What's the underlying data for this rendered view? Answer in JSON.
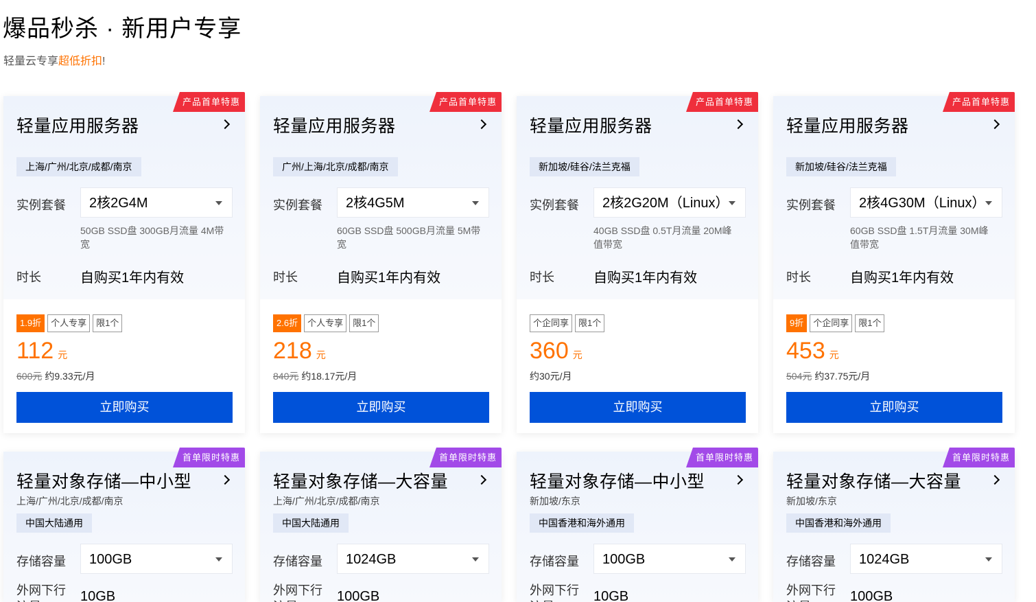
{
  "header": {
    "title": "爆品秒杀 · 新用户专享",
    "subtitle_prefix": "轻量云专享",
    "subtitle_highlight": "超低折扣",
    "subtitle_suffix": "!"
  },
  "colors": {
    "accent_orange": "#ff7200",
    "buy_blue": "#0052d9",
    "ribbon_red": "#ef2f3c",
    "ribbon_purple": "#a24ae8"
  },
  "server_cards": [
    {
      "ribbon": "产品首单特惠",
      "title": "轻量应用服务器",
      "region": "上海/广州/北京/成都/南京",
      "plan_label": "实例套餐",
      "plan": "2核2G4M",
      "plan_desc": "50GB SSD盘 300GB月流量 4M带宽",
      "duration_label": "时长",
      "duration": "自购买1年内有效",
      "discount": "1.9折",
      "tags": [
        "个人专享",
        "限1个"
      ],
      "price": "112",
      "unit": "元",
      "original_price": "600元",
      "monthly": "约9.33元/月",
      "buy_label": "立即购买"
    },
    {
      "ribbon": "产品首单特惠",
      "title": "轻量应用服务器",
      "region": "广州/上海/北京/成都/南京",
      "plan_label": "实例套餐",
      "plan": "2核4G5M",
      "plan_desc": "60GB SSD盘 500GB月流量 5M带宽",
      "duration_label": "时长",
      "duration": "自购买1年内有效",
      "discount": "2.6折",
      "tags": [
        "个人专享",
        "限1个"
      ],
      "price": "218",
      "unit": "元",
      "original_price": "840元",
      "monthly": "约18.17元/月",
      "buy_label": "立即购买"
    },
    {
      "ribbon": "产品首单特惠",
      "title": "轻量应用服务器",
      "region": "新加坡/硅谷/法兰克福",
      "plan_label": "实例套餐",
      "plan": "2核2G20M（Linux）",
      "plan_desc": "40GB SSD盘 0.5T月流量 20M峰值带宽",
      "duration_label": "时长",
      "duration": "自购买1年内有效",
      "discount": "",
      "tags": [
        "个企同享",
        "限1个"
      ],
      "price": "360",
      "unit": "元",
      "original_price": "",
      "monthly": "约30元/月",
      "buy_label": "立即购买"
    },
    {
      "ribbon": "产品首单特惠",
      "title": "轻量应用服务器",
      "region": "新加坡/硅谷/法兰克福",
      "plan_label": "实例套餐",
      "plan": "2核4G30M（Linux）",
      "plan_desc": "60GB SSD盘 1.5T月流量 30M峰值带宽",
      "duration_label": "时长",
      "duration": "自购买1年内有效",
      "discount": "9折",
      "tags": [
        "个企同享",
        "限1个"
      ],
      "price": "453",
      "unit": "元",
      "original_price": "504元",
      "monthly": "约37.75元/月",
      "buy_label": "立即购买"
    }
  ],
  "storage_cards": [
    {
      "ribbon": "首单限时特惠",
      "title": "轻量对象存储—中小型",
      "regions": "上海/广州/北京/成都/南京",
      "scope": "中国大陆通用",
      "capacity_label": "存储容量",
      "capacity": "100GB",
      "traffic_label": "外网下行流量",
      "traffic": "10GB"
    },
    {
      "ribbon": "首单限时特惠",
      "title": "轻量对象存储—大容量",
      "regions": "上海/广州/北京/成都/南京",
      "scope": "中国大陆通用",
      "capacity_label": "存储容量",
      "capacity": "1024GB",
      "traffic_label": "外网下行流量",
      "traffic": "100GB"
    },
    {
      "ribbon": "首单限时特惠",
      "title": "轻量对象存储—中小型",
      "regions": "新加坡/东京",
      "scope": "中国香港和海外通用",
      "capacity_label": "存储容量",
      "capacity": "100GB",
      "traffic_label": "外网下行流量",
      "traffic": "10GB"
    },
    {
      "ribbon": "首单限时特惠",
      "title": "轻量对象存储—大容量",
      "regions": "新加坡/东京",
      "scope": "中国香港和海外通用",
      "capacity_label": "存储容量",
      "capacity": "1024GB",
      "traffic_label": "外网下行流量",
      "traffic": "100GB"
    }
  ]
}
